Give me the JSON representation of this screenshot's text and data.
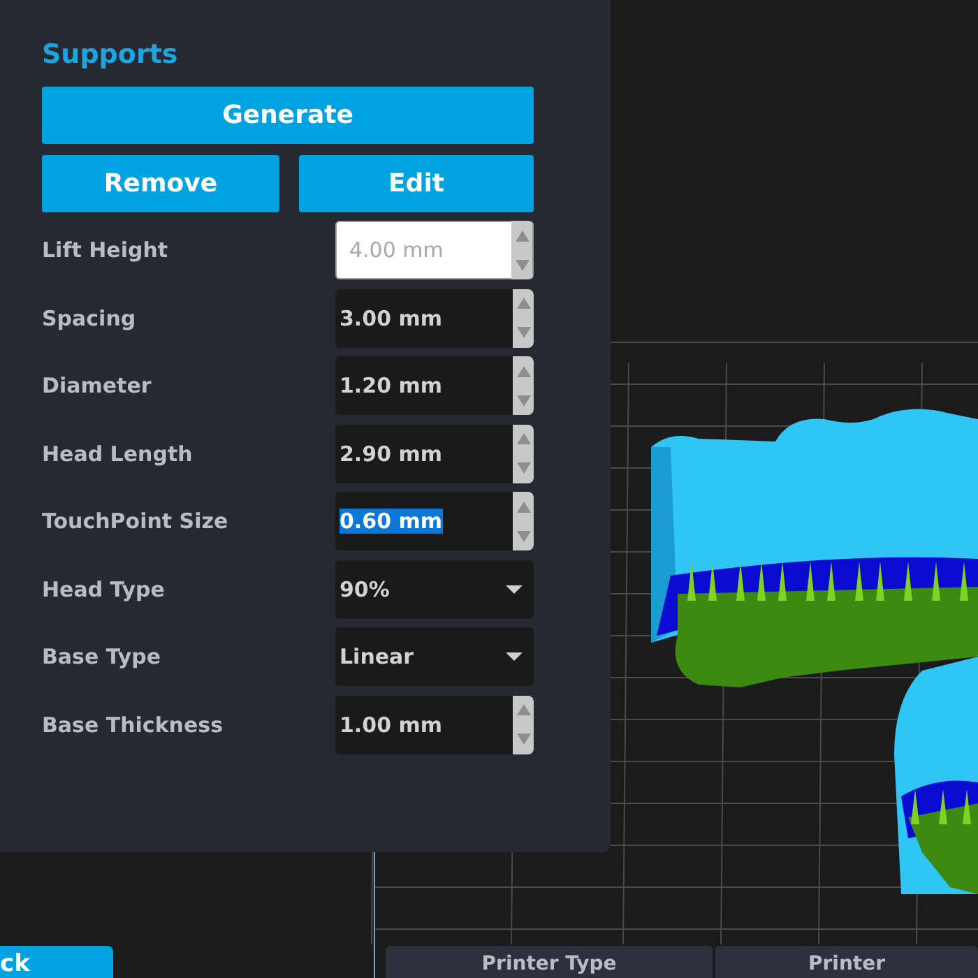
{
  "panel": {
    "title": "Supports",
    "buttons": [
      {
        "label": "Generate",
        "kind": "wide"
      },
      {
        "label": "Remove",
        "kind": "half"
      },
      {
        "label": "Edit",
        "kind": "half"
      }
    ],
    "fields": [
      {
        "label": "Lift Height",
        "kind": "spinner",
        "value": "4.00 mm",
        "disabled": true,
        "highlighted": false
      },
      {
        "label": "Spacing",
        "kind": "spinner",
        "value": "3.00 mm",
        "disabled": false,
        "highlighted": false
      },
      {
        "label": "Diameter",
        "kind": "spinner",
        "value": "1.20 mm",
        "disabled": false,
        "highlighted": false
      },
      {
        "label": "Head Length",
        "kind": "spinner",
        "value": "2.90 mm",
        "disabled": false,
        "highlighted": false
      },
      {
        "label": "TouchPoint Size",
        "kind": "spinner",
        "value": "0.60 mm",
        "disabled": false,
        "highlighted": true
      },
      {
        "label": "Head Type",
        "kind": "dropdown",
        "value": "90%",
        "disabled": false,
        "highlighted": false
      },
      {
        "label": "Base Type",
        "kind": "dropdown",
        "value": "Linear",
        "disabled": false,
        "highlighted": false
      },
      {
        "label": "Base Thickness",
        "kind": "spinner",
        "value": "1.00 mm",
        "disabled": false,
        "highlighted": false
      }
    ]
  },
  "back_button": {
    "label": "ck"
  },
  "bottom_tabs": [
    {
      "label": "Printer Type",
      "selected": false
    },
    {
      "label": "Printer",
      "selected": false
    }
  ]
}
